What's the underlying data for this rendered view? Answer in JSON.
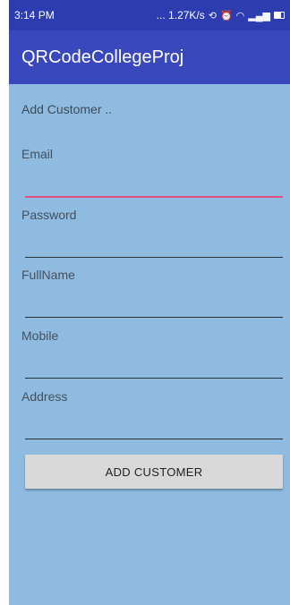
{
  "status_bar": {
    "time": "3:14 PM",
    "network_speed": "... 1.27K/s",
    "icons": [
      "data-saver-icon",
      "alarm-icon",
      "wifi-icon",
      "signal-icon",
      "battery-icon"
    ]
  },
  "app_bar": {
    "title": "QRCodeCollegeProj"
  },
  "form": {
    "header": "Add Customer ..",
    "fields": [
      {
        "label": "Email",
        "value": ""
      },
      {
        "label": "Password",
        "value": ""
      },
      {
        "label": "FullName",
        "value": ""
      },
      {
        "label": "Mobile",
        "value": ""
      },
      {
        "label": "Address",
        "value": ""
      }
    ],
    "submit_label": "ADD CUSTOMER"
  },
  "colors": {
    "status_bar": "#2d3db0",
    "app_bar": "#3949bd",
    "background": "#8fbbe0",
    "focused_underline": "#e04f82",
    "button": "#d9d9d9"
  }
}
